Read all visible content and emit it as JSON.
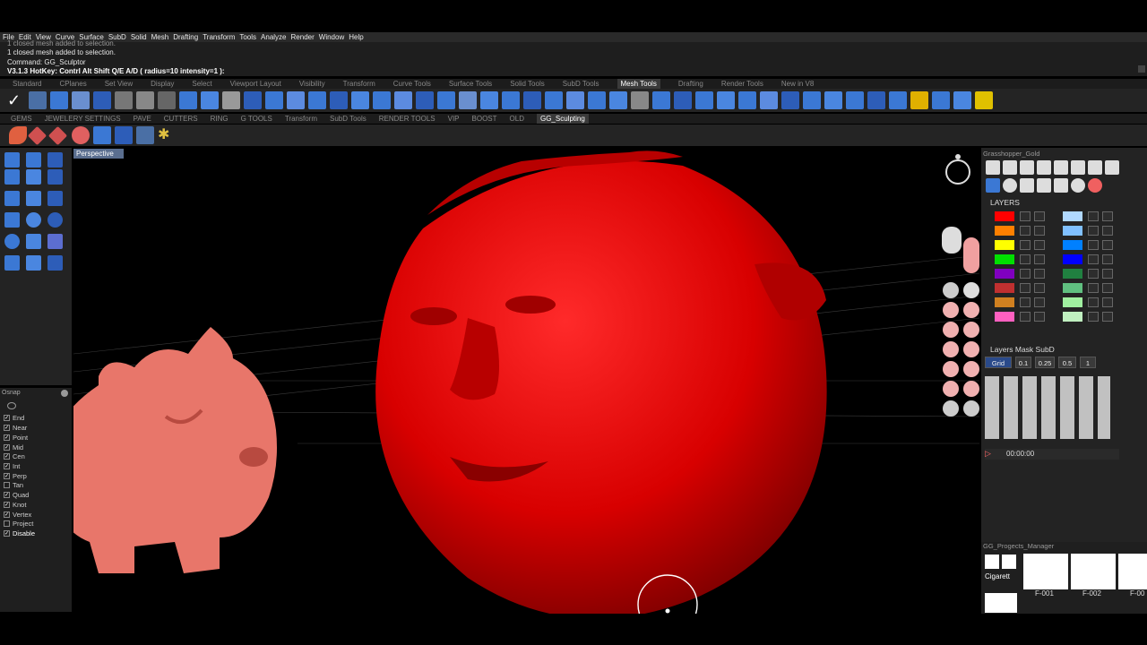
{
  "menu": [
    "File",
    "Edit",
    "View",
    "Curve",
    "Surface",
    "SubD",
    "Solid",
    "Mesh",
    "Drafting",
    "Transform",
    "Tools",
    "Analyze",
    "Render",
    "Window",
    "Help"
  ],
  "command": {
    "line0": "1 closed mesh added to selection.",
    "line1": "1 closed mesh added to selection.",
    "line2": "Command: GG_Sculptor",
    "line3": "V3.1.3 HotKey: Contrl Alt Shift Q/E A/D ( radius=10  intensity=1 ):"
  },
  "tabs_row1": [
    "Standard",
    "CPlanes",
    "Set View",
    "Display",
    "Select",
    "Viewport Layout",
    "Visibility",
    "Transform",
    "Curve Tools",
    "Surface Tools",
    "Solid Tools",
    "SubD Tools",
    "Mesh Tools",
    "Drafting",
    "Render Tools",
    "New in V8"
  ],
  "tabs_row1_active": "Mesh Tools",
  "tabs_row2": [
    "GEMS",
    "JEWELERY SETTINGS",
    "PAVE",
    "CUTTERS",
    "RING",
    "G TOOLS",
    "Transform",
    "SubD Tools",
    "RENDER TOOLS",
    "VIP",
    "BOOST",
    "OLD",
    "GG_Sculpting"
  ],
  "tabs_row2_active": "GG_Sculpting",
  "viewport": {
    "label": "Perspective"
  },
  "osnap": {
    "title": "Osnap",
    "items": [
      {
        "label": "End",
        "checked": true
      },
      {
        "label": "Near",
        "checked": true
      },
      {
        "label": "Point",
        "checked": true
      },
      {
        "label": "Mid",
        "checked": true
      },
      {
        "label": "Cen",
        "checked": true
      },
      {
        "label": "Int",
        "checked": true
      },
      {
        "label": "Perp",
        "checked": true
      },
      {
        "label": "Tan",
        "checked": false
      },
      {
        "label": "Quad",
        "checked": true
      },
      {
        "label": "Knot",
        "checked": true
      },
      {
        "label": "Vertex",
        "checked": true
      },
      {
        "label": "Project",
        "checked": false
      },
      {
        "label": "Disable",
        "checked": true
      }
    ]
  },
  "right": {
    "panel_title": "Grasshopper_Gold",
    "layers_title": "LAYERS",
    "layers_mask_title": "Layers Mask SubD",
    "grid_chips": [
      "Grid",
      "0.1",
      "0.25",
      "0.5",
      "1"
    ],
    "timer": "00:00:00",
    "projects_title": "GG_Progects_Manager",
    "project_label": "Cigarett",
    "project_ids": [
      "F-001",
      "F-002",
      "F-00"
    ],
    "layer_colors_left": [
      "#ff0000",
      "#ff8000",
      "#ffff00",
      "#00e000",
      "#8000c0",
      "#c03030",
      "#d08020",
      "#ff60c0"
    ],
    "layer_colors_right": [
      "#b0d8ff",
      "#80c0ff",
      "#0080ff",
      "#0000ff",
      "#208040",
      "#60c080",
      "#a0f0a0",
      "#c0f0c0"
    ]
  },
  "colors": {
    "mesh": "#e00000",
    "accent": "#5a6e8f",
    "rhino_mascot": "#e8766a"
  }
}
